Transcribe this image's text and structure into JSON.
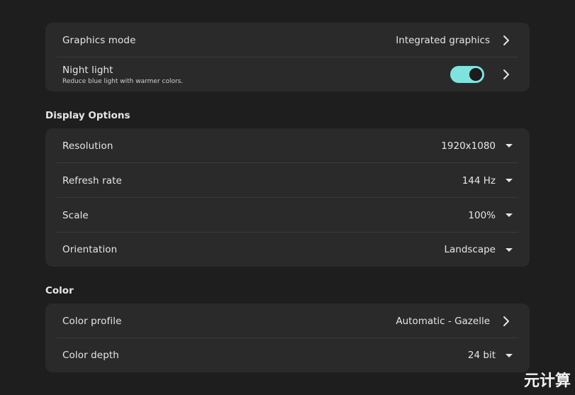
{
  "top_section": {
    "graphics_mode": {
      "label": "Graphics mode",
      "value": "Integrated graphics"
    },
    "night_light": {
      "label": "Night light",
      "sublabel": "Reduce blue light with warmer colors.",
      "enabled": true
    }
  },
  "display_options": {
    "title": "Display Options",
    "rows": [
      {
        "label": "Resolution",
        "value": "1920x1080"
      },
      {
        "label": "Refresh rate",
        "value": "144 Hz"
      },
      {
        "label": "Scale",
        "value": "100%"
      },
      {
        "label": "Orientation",
        "value": "Landscape"
      }
    ]
  },
  "color": {
    "title": "Color",
    "profile": {
      "label": "Color profile",
      "value": "Automatic - Gazelle"
    },
    "depth": {
      "label": "Color depth",
      "value": "24 bit"
    }
  },
  "watermark": "元计算",
  "colors": {
    "background": "#1e1e1e",
    "card": "#2a2a2a",
    "toggle_on": "#7fe3dd"
  }
}
